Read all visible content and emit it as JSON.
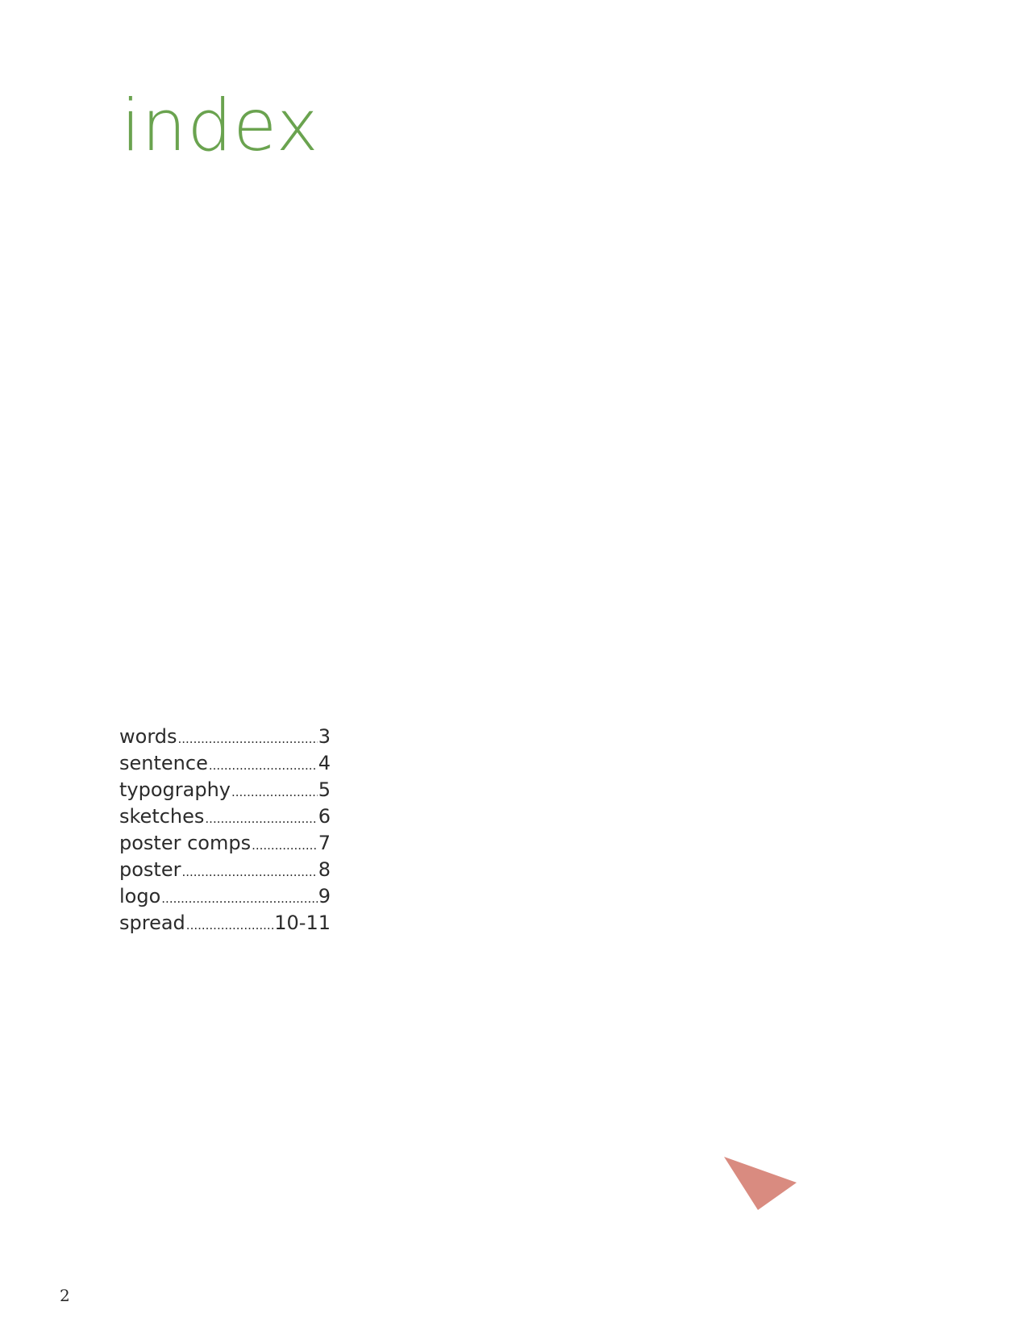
{
  "page": {
    "title": "index",
    "page_number": "2"
  },
  "toc": {
    "entries": [
      {
        "label": "words",
        "page": "3"
      },
      {
        "label": "sentence",
        "page": "4"
      },
      {
        "label": "typography",
        "page": "5"
      },
      {
        "label": "sketches",
        "page": "6"
      },
      {
        "label": "poster comps",
        "page": "7"
      },
      {
        "label": "poster",
        "page": "8"
      },
      {
        "label": "logo",
        "page": "9"
      },
      {
        "label": "spread",
        "page": "10-11"
      }
    ]
  },
  "decoration": {
    "icon": "triangle-arrow-icon"
  },
  "colors": {
    "title": "#6aa34f",
    "text": "#2b2b2b",
    "accent_shape": "#d98b80"
  }
}
